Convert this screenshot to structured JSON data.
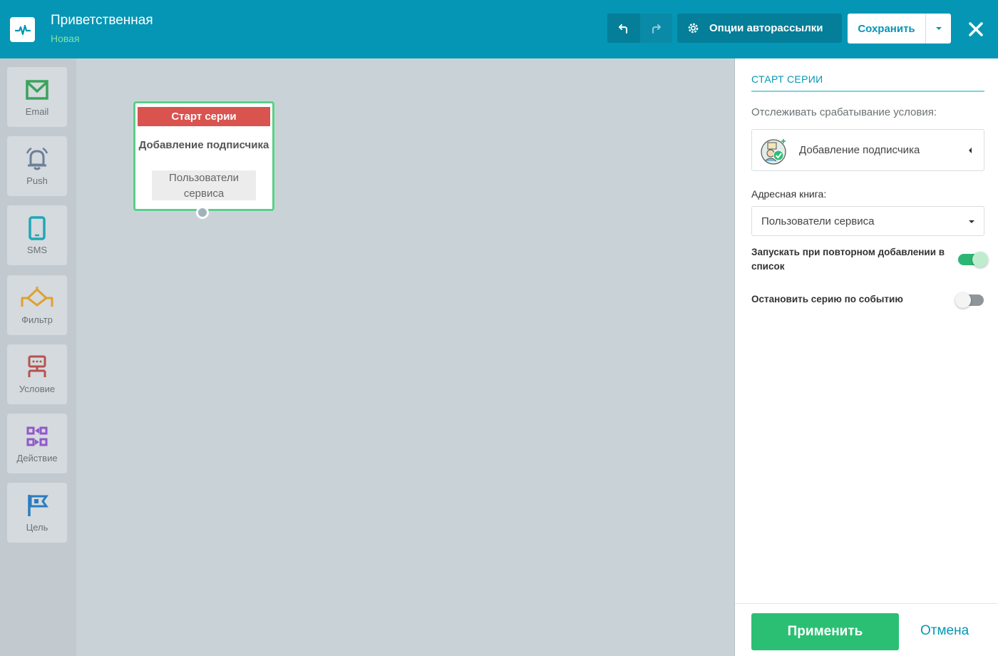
{
  "header": {
    "title": "Приветственная",
    "subtitle": "Новая",
    "options_label": "Опции авторассылки",
    "save_label": "Сохранить"
  },
  "toolbox": {
    "items": [
      {
        "label": "Email",
        "icon": "envelope-icon",
        "color": "#3aa35c"
      },
      {
        "label": "Push",
        "icon": "bell-icon",
        "color": "#6d7f99"
      },
      {
        "label": "SMS",
        "icon": "phone-icon",
        "color": "#1fa8b5"
      },
      {
        "label": "Фильтр",
        "icon": "filter-icon",
        "color": "#e0a030"
      },
      {
        "label": "Условие",
        "icon": "condition-icon",
        "color": "#b5524f"
      },
      {
        "label": "Действие",
        "icon": "action-icon",
        "color": "#9158c9"
      },
      {
        "label": "Цель",
        "icon": "flag-icon",
        "color": "#2b7cc0"
      }
    ]
  },
  "canvas": {
    "node": {
      "header": "Старт серии",
      "trigger": "Добавление подписчика",
      "list": "Пользователи сервиса"
    }
  },
  "panel": {
    "title": "СТАРТ СЕРИИ",
    "track_label": "Отслеживать срабатывание условия:",
    "trigger_value": "Добавление подписчика",
    "book_label": "Адресная книга:",
    "book_value": "Пользователи сервиса",
    "option_repeat": {
      "label": "Запускать при повторном добавлении в список",
      "enabled": true
    },
    "option_stop": {
      "label": "Остановить серию по событию",
      "enabled": false
    },
    "apply_label": "Применить",
    "cancel_label": "Отмена"
  },
  "colors": {
    "header_bg": "#0596b5",
    "accent_green": "#2bbf74",
    "node_header": "#d9534f"
  }
}
